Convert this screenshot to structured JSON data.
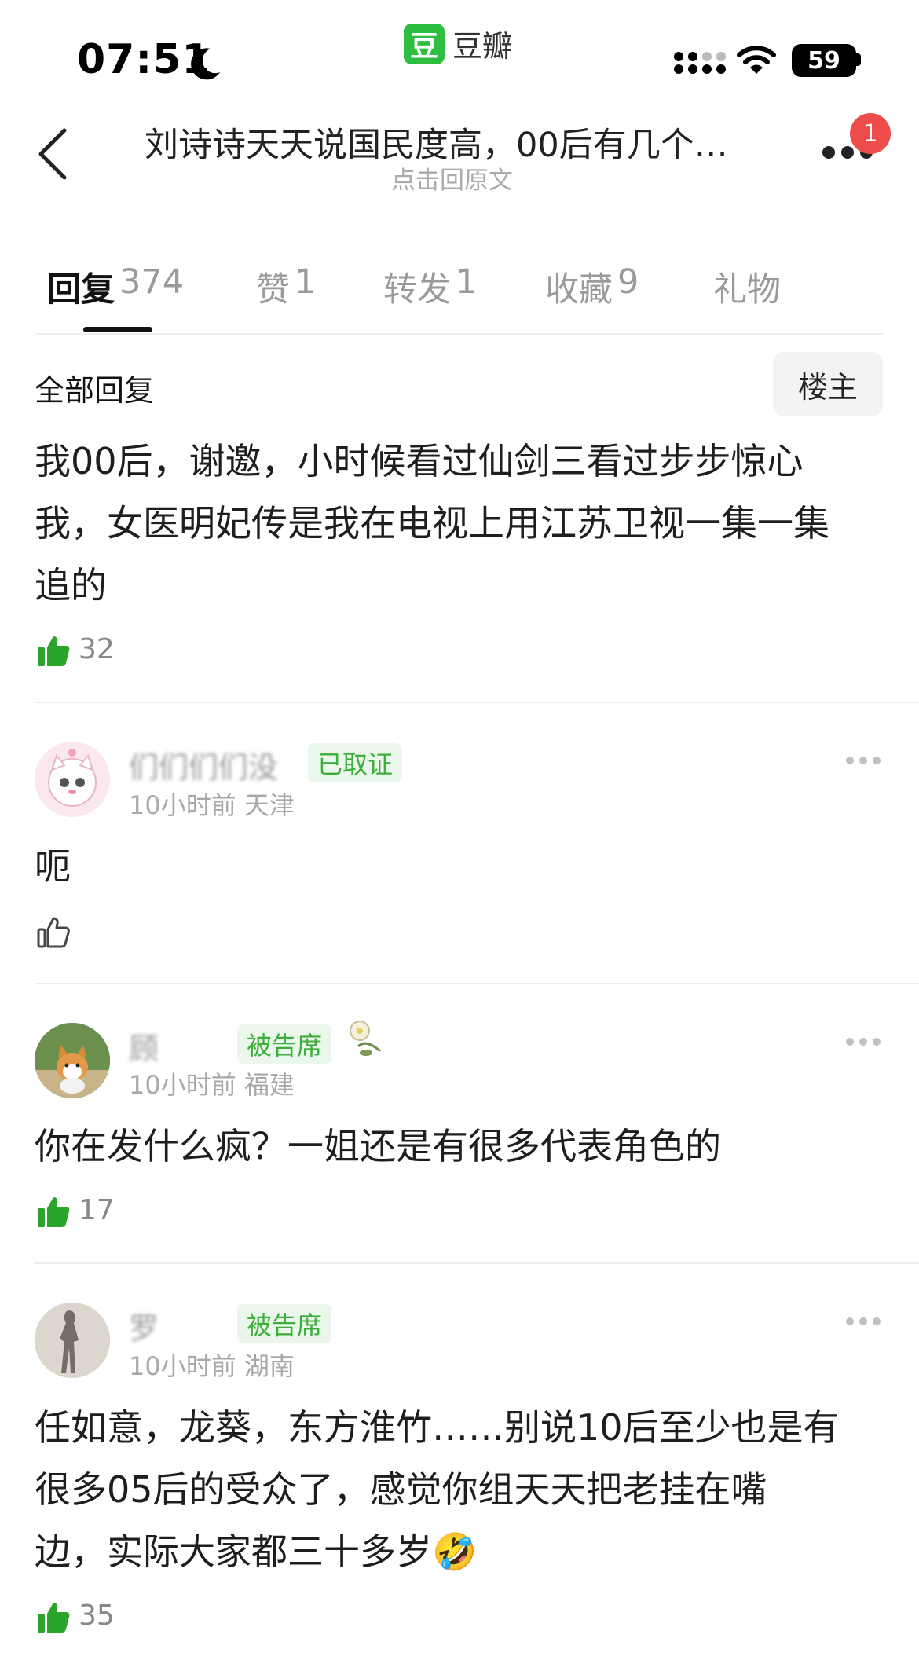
{
  "status_bar": {
    "time": "07:51",
    "battery": "59"
  },
  "app": {
    "logo_char": "豆",
    "name": "豆瓣"
  },
  "nav": {
    "title": "刘诗诗天天说国民度高，00后有几个…",
    "subtitle": "点击回原文",
    "notification_count": "1"
  },
  "tabs": [
    {
      "label": "回复",
      "count": "374",
      "active": true
    },
    {
      "label": "赞",
      "count": "1"
    },
    {
      "label": "转发",
      "count": "1"
    },
    {
      "label": "收藏",
      "count": "9"
    },
    {
      "label": "礼物",
      "count": ""
    }
  ],
  "filter": {
    "label": "全部回复",
    "op_button": "楼主"
  },
  "op_comment": {
    "lines": [
      "我00后，谢邀，小时候看过仙剑三看过步步惊心",
      "我，女医明妃传是我在电视上用江苏卫视一集一集",
      "追的"
    ],
    "likes": "32"
  },
  "comments": [
    {
      "name": "们们们们没",
      "badge": "已取证",
      "time": "10小时前",
      "location": "天津",
      "text_lines": [
        "呃"
      ],
      "likes": ""
    },
    {
      "name": "顾",
      "badge": "被告席",
      "time": "10小时前",
      "location": "福建",
      "text_lines": [
        "你在发什么疯？一姐还是有很多代表角色的"
      ],
      "likes": "17"
    },
    {
      "name": "罗",
      "badge": "被告席",
      "time": "10小时前",
      "location": "湖南",
      "text_lines": [
        "任如意，龙葵，东方淮竹……别说10后至少也是有",
        "很多05后的受众了，感觉你组天天把老挂在嘴",
        "边，实际大家都三十多岁🤣"
      ],
      "likes": "35"
    }
  ],
  "colors": {
    "brand_green": "#2dbd3f",
    "like_green": "#2aa52a",
    "badge_red": "#ee4b4b"
  }
}
